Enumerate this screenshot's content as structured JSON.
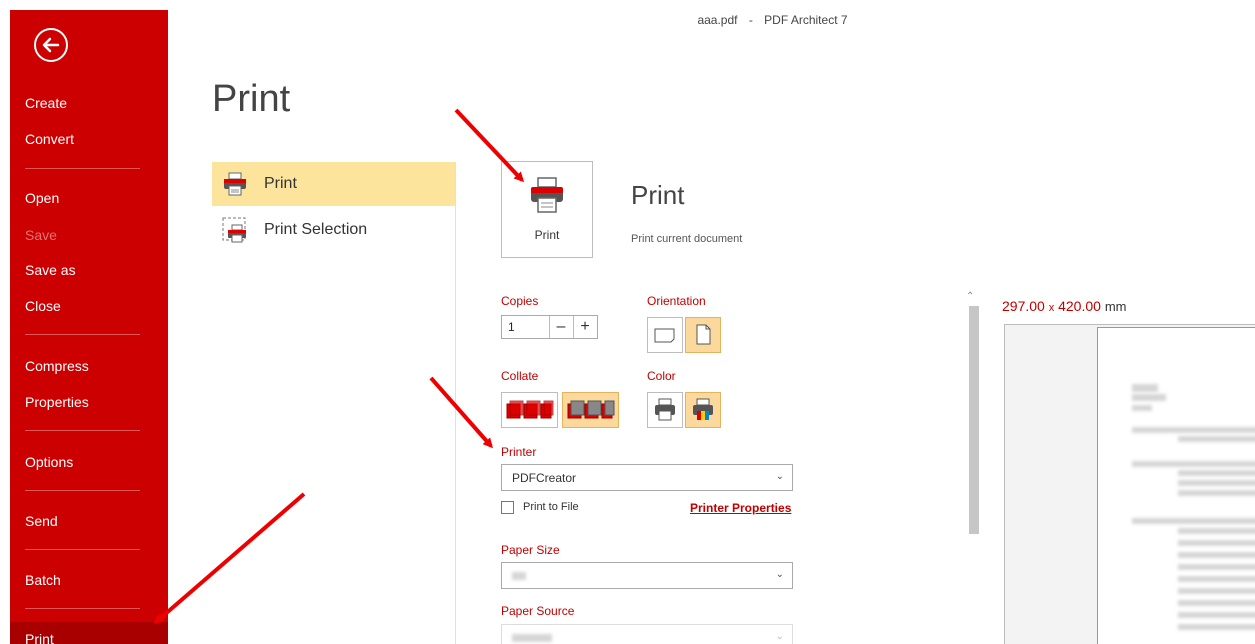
{
  "window": {
    "filename": "aaa.pdf",
    "separator": "-",
    "app_name": "PDF Architect 7"
  },
  "sidebar": {
    "back_icon": "back-arrow-icon",
    "items": [
      {
        "label": "Create"
      },
      {
        "label": "Convert"
      },
      {
        "label": "Open"
      },
      {
        "label": "Save",
        "disabled": true
      },
      {
        "label": "Save as"
      },
      {
        "label": "Close"
      },
      {
        "label": "Compress"
      },
      {
        "label": "Properties"
      },
      {
        "label": "Options"
      },
      {
        "label": "Send"
      },
      {
        "label": "Batch"
      },
      {
        "label": "Print",
        "active": true
      }
    ]
  },
  "page": {
    "title": "Print"
  },
  "print_options": [
    {
      "label": "Print",
      "selected": true,
      "icon": "printer-icon"
    },
    {
      "label": "Print Selection",
      "selected": false,
      "icon": "print-selection-icon"
    }
  ],
  "print_action": {
    "button_label": "Print",
    "heading": "Print",
    "description": "Print current document"
  },
  "settings": {
    "copies": {
      "label": "Copies",
      "value": "1",
      "minus": "–",
      "plus": "+"
    },
    "orientation": {
      "label": "Orientation",
      "selected": "portrait",
      "options": [
        "landscape-icon",
        "portrait-icon"
      ]
    },
    "collate": {
      "label": "Collate",
      "selected": "collated",
      "options": [
        "uncollated-icon",
        "collated-icon"
      ]
    },
    "color": {
      "label": "Color",
      "selected": "color",
      "options": [
        "grayscale-printer-icon",
        "color-printer-icon"
      ]
    },
    "printer": {
      "label": "Printer",
      "value": "PDFCreator"
    },
    "print_to_file": {
      "label": "Print to File",
      "checked": false
    },
    "printer_properties": {
      "label": "Printer Properties"
    },
    "paper_size": {
      "label": "Paper Size"
    },
    "paper_source": {
      "label": "Paper Source"
    }
  },
  "preview": {
    "width": "297.00",
    "x": "x",
    "height": "420.00",
    "unit": "mm"
  },
  "colors": {
    "accent": "#cc0000",
    "selected": "#fde49c",
    "tile_on": "#fbd89b",
    "label_red": "#c00000"
  }
}
